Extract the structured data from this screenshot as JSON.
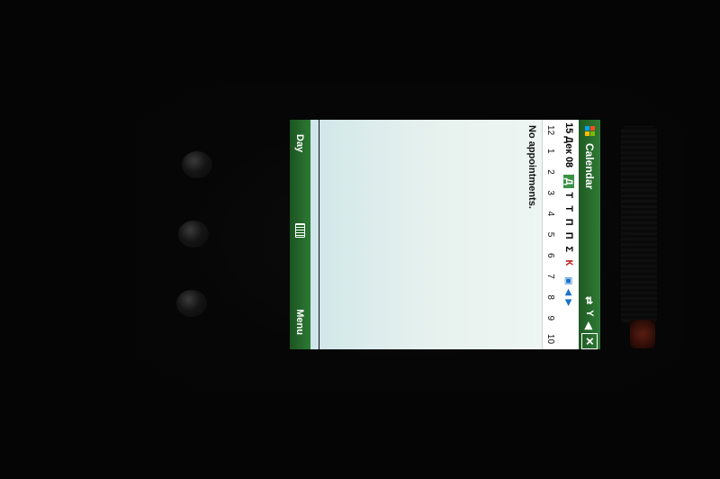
{
  "titlebar": {
    "title": "Calendar",
    "close": "✕"
  },
  "week": {
    "date": "15 Дек 08",
    "days": [
      "Д",
      "Т",
      "Т",
      "П",
      "П",
      "Σ",
      "К"
    ],
    "selected_index": 0
  },
  "hours": [
    "12",
    "1",
    "2",
    "3",
    "4",
    "5",
    "6",
    "7",
    "8",
    "9",
    "10"
  ],
  "main": {
    "empty_text": "No appointments."
  },
  "softkeys": {
    "left": "Day",
    "right": "Menu"
  },
  "colors": {
    "bar_green": "#2f7a35",
    "selected_day": "#3c9244",
    "weekend_red": "#c01a1a"
  }
}
